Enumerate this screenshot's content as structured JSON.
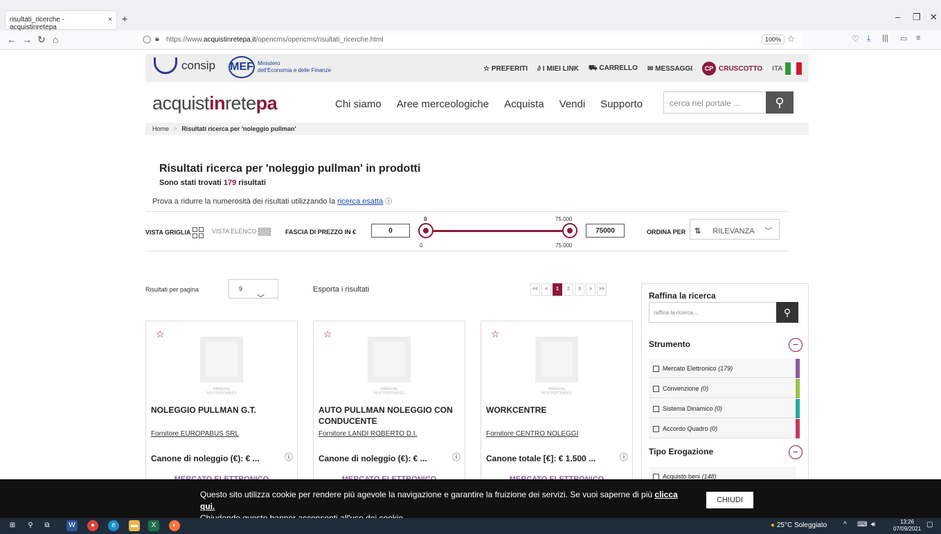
{
  "browser": {
    "tab_title": "risultati_ricerche - acquistinretepa",
    "tab_close": "×",
    "new_tab": "+",
    "url_prefix": "https://www.",
    "url_domain": "acquistinretepa.it",
    "url_path": "/opencms/opencms/risultati_ricerche.html",
    "zoom": "100%"
  },
  "topbar": {
    "consip": "consip",
    "mef": "MEF",
    "mef_line1": "Ministero",
    "mef_line2": "dell'Economia e delle Finanze",
    "preferiti": "PREFERITI",
    "miei_link": "I MIEI LINK",
    "carrello": "CARRELLO",
    "messaggi": "MESSAGGI",
    "cp": "CP",
    "cruscotto": "CRUSCOTTO",
    "lang": "ITA"
  },
  "header": {
    "brand_a": "acquist",
    "brand_b": "in",
    "brand_c": "rete",
    "brand_d": "pa",
    "menu": [
      "Chi siamo",
      "Aree merceologiche",
      "Acquista",
      "Vendi",
      "Supporto"
    ],
    "search_placeholder": "cerca nel portale ..."
  },
  "breadcrumb": {
    "home": "Home",
    "sep": ">",
    "current": "Risultati ricerca per 'noleggio pullman'"
  },
  "results": {
    "title": "Risultati ricerca per 'noleggio pullman' in prodotti",
    "found_prefix": "Sono stati trovati",
    "count": "179",
    "found_suffix": "risultati",
    "hint": "Prova a ridurre la numerosità dei risultati utilizzando la",
    "hint_link": "ricerca esatta"
  },
  "filters": {
    "vista_griglia": "VISTA GRIGLIA",
    "vista_elenco": "VISTA ELENCO",
    "fascia": "FASCIA DI PREZZO IN €",
    "min_value": "0",
    "max_value": "75000",
    "slider_min_top": "0",
    "slider_max_top": "75.000",
    "slider_min_bottom": "0",
    "slider_max_bottom": "75.000",
    "ordina": "ORDINA PER",
    "sort_value": "RILEVANZA",
    "colors": {
      "accent": "#8b1a3a"
    }
  },
  "toolbar": {
    "per_page_label": "Risultati per pagina",
    "per_page_value": "9",
    "export": "Esporta i risultati",
    "pager": [
      "<<",
      "<",
      "1",
      "2",
      "3",
      ">",
      ">>"
    ],
    "pager_active": "1"
  },
  "products": [
    {
      "name": "NOLEGGIO PULLMAN G.T.",
      "supplier": "Fornitore EUROPABUS SRL",
      "price": "Canone di noleggio (€): € ...",
      "strumento": "MERCATO ELETTRONICO"
    },
    {
      "name": "AUTO PULLMAN NOLEGGIO CON CONDUCENTE",
      "supplier": "Fornitore LANDI ROBERTO D.I.",
      "price": "Canone di noleggio (€): € ...",
      "strumento": "MERCATO ELETTRONICO"
    },
    {
      "name": "WORKCENTRE",
      "supplier": "Fornitore CENTRO NOLEGGI",
      "price": "Canone totale [€]: € 1.500 ...",
      "strumento": "MERCATO ELETTRONICO"
    }
  ],
  "noimg": {
    "line1": "IMMAGINE",
    "line2": "NON DISPONIBILE"
  },
  "sidebar": {
    "title": "Raffina la ricerca",
    "search_placeholder": "raffina la ricerca...",
    "strumento_title": "Strumento",
    "strumento_options": [
      {
        "label": "Mercato Elettronico",
        "count": "(179)",
        "color": "#8b5b9f"
      },
      {
        "label": "Convenzione",
        "count": "(0)",
        "color": "#9bbf4a"
      },
      {
        "label": "Sistema Dinamico",
        "count": "(0)",
        "color": "#2aa6a6"
      },
      {
        "label": "Accordo Quadro",
        "count": "(0)",
        "color": "#c23a5a"
      }
    ],
    "erogazione_title": "Tipo Erogazione",
    "erogazione_options": [
      {
        "label": "Acquisto beni",
        "count": "(148)"
      }
    ]
  },
  "cookie": {
    "text": "Questo sito utilizza cookie per rendere più agevole la navigazione e garantire la fruizione dei servizi. Se vuoi saperne di più",
    "link": "clicca qui.",
    "text2": "Chiudendo questo banner acconsenti all'uso dei cookie.",
    "button": "CHIUDI"
  },
  "taskbar": {
    "weather": "25°C Soleggiato",
    "time": "13:26",
    "date": "07/09/2021"
  }
}
